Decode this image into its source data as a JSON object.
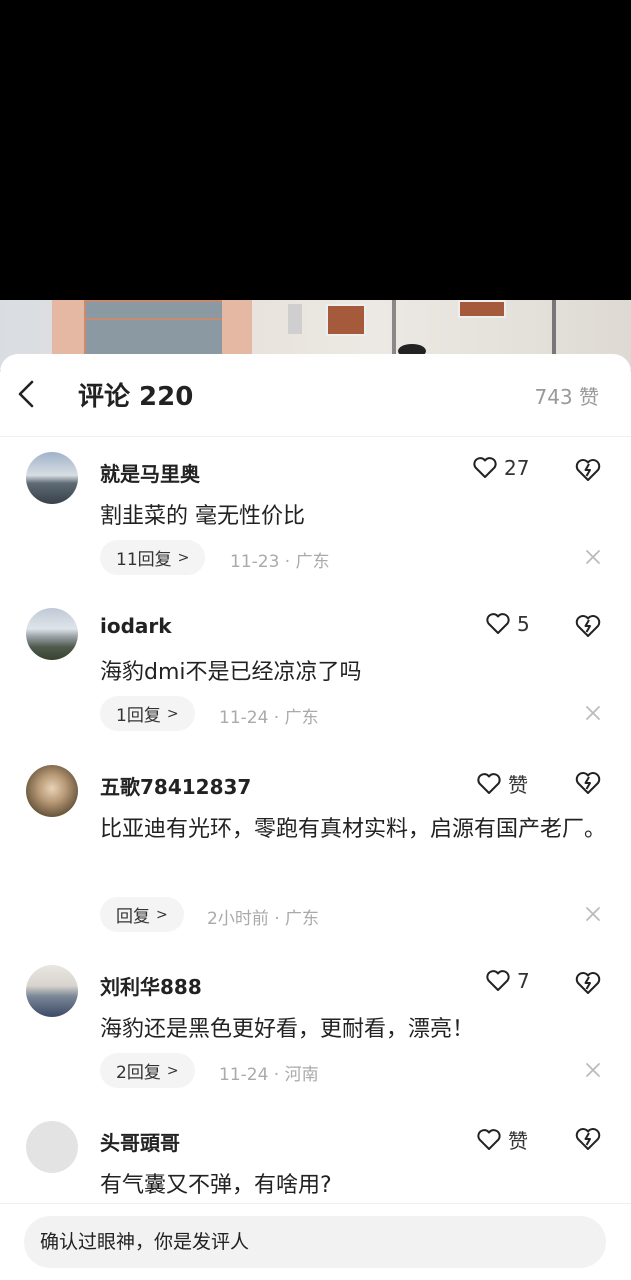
{
  "header": {
    "title": "评论 220",
    "likes_total": "743 赞"
  },
  "comments": [
    {
      "username": "就是马里奥",
      "text": "割韭菜的 毫无性价比",
      "likes": "27",
      "reply_label": "11回复",
      "meta": "11-23 · 广东"
    },
    {
      "username": "iodark",
      "text": "海豹dmi不是已经凉凉了吗",
      "likes": "5",
      "reply_label": "1回复",
      "meta": "11-24 · 广东"
    },
    {
      "username": "五歌78412837",
      "text": "比亚迪有光环，零跑有真材实料，启源有国产老厂。",
      "likes": "赞",
      "reply_label": "回复",
      "meta": "2小时前 · 广东"
    },
    {
      "username": "刘利华888",
      "text": "海豹还是黑色更好看，更耐看，漂亮！",
      "likes": "7",
      "reply_label": "2回复",
      "meta": "11-24 · 河南"
    },
    {
      "username": "头哥頭哥",
      "text": "有气囊又不弹，有啥用?",
      "likes": "赞"
    }
  ],
  "footer": {
    "input_placeholder": "确认过眼神，你是发评人"
  },
  "icons": {
    "back": "chevron-left-icon",
    "like": "heart-outline-icon",
    "dislike": "broken-heart-icon",
    "close": "close-icon",
    "reply_chevron": "chevron-right-icon"
  },
  "colors": {
    "text_primary": "#222222",
    "text_secondary": "#aaaaaa",
    "chip_bg": "#f4f4f4",
    "sheet_bg": "#ffffff"
  }
}
